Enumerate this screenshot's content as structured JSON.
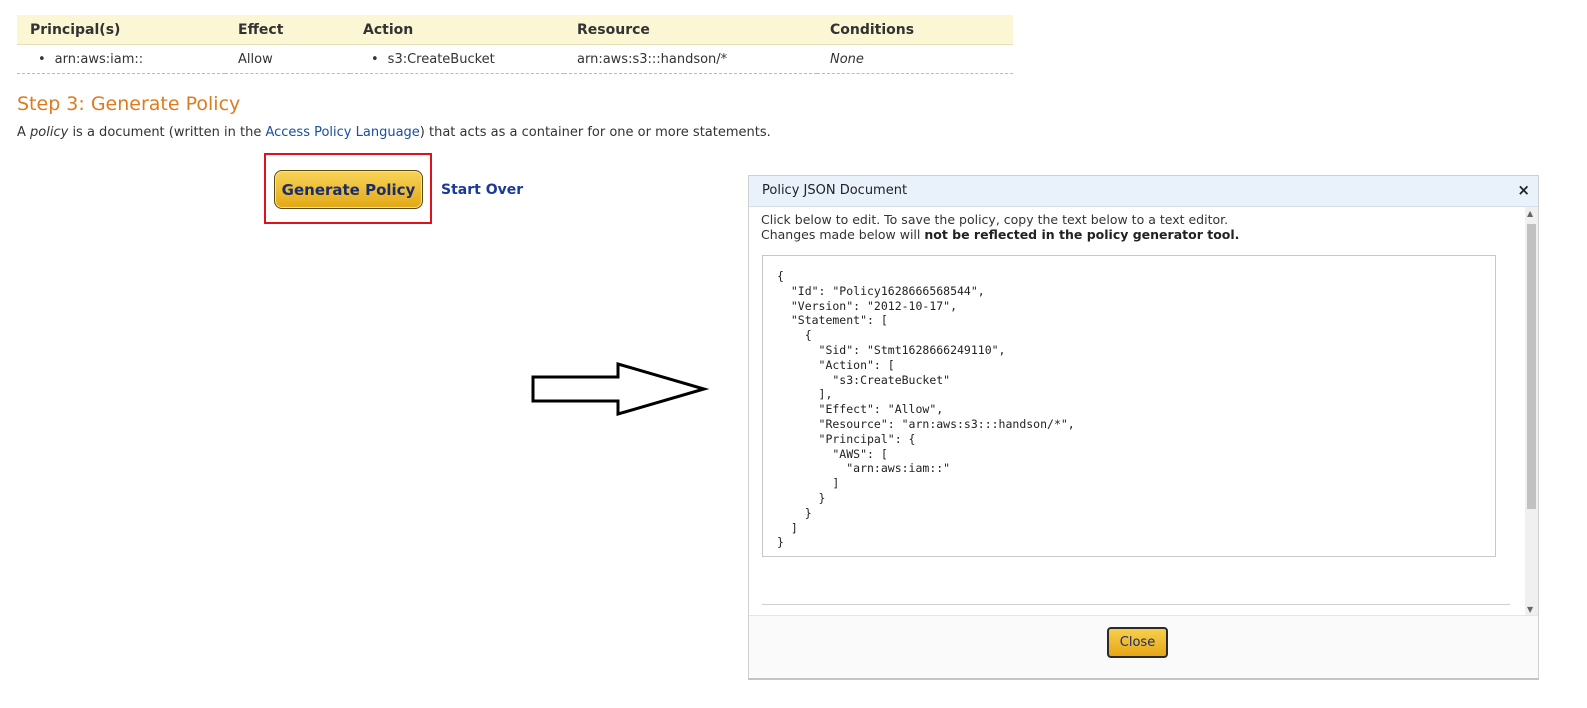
{
  "statement_table": {
    "headers": [
      "Principal(s)",
      "Effect",
      "Action",
      "Resource",
      "Conditions"
    ],
    "row": {
      "principal": "arn:aws:iam::",
      "effect": "Allow",
      "action": "s3:CreateBucket",
      "resource": "arn:aws:s3:::handson/*",
      "conditions": "None"
    }
  },
  "step3": {
    "title": "Step 3: Generate Policy",
    "desc_prefix": "A ",
    "desc_policy": "policy",
    "desc_mid": " is a document (written in the ",
    "desc_link": "Access Policy Language",
    "desc_suffix": ") that acts as a container for one or more statements.",
    "generate_button": "Generate Policy",
    "start_over_link": "Start Over"
  },
  "dialog": {
    "title": "Policy JSON Document",
    "close_x": "×",
    "note_line1": "Click below to edit. To save the policy, copy the text below to a text editor.",
    "note_line2_prefix": "Changes made below will ",
    "note_line2_bold": "not be reflected in the policy generator tool.",
    "policy_json": "{\n  \"Id\": \"Policy1628666568544\",\n  \"Version\": \"2012-10-17\",\n  \"Statement\": [\n    {\n      \"Sid\": \"Stmt1628666249110\",\n      \"Action\": [\n        \"s3:CreateBucket\"\n      ],\n      \"Effect\": \"Allow\",\n      \"Resource\": \"arn:aws:s3:::handson/*\",\n      \"Principal\": {\n        \"AWS\": [\n          \"arn:aws:iam::\"\n        ]\n      }\n    }\n  ]\n}",
    "close_button": "Close"
  },
  "icons": {
    "arrow": "right-arrow-outline-icon",
    "scroll_up": "chevron-up-icon",
    "scroll_down": "chevron-down-icon"
  },
  "colors": {
    "header_bg": "#fbf6d3",
    "step_title": "#e07a1f",
    "link": "#1a4ea0",
    "button_gold": "#f0c030",
    "highlight_red": "#e0101c",
    "dialog_header": "#e9f1fb"
  }
}
